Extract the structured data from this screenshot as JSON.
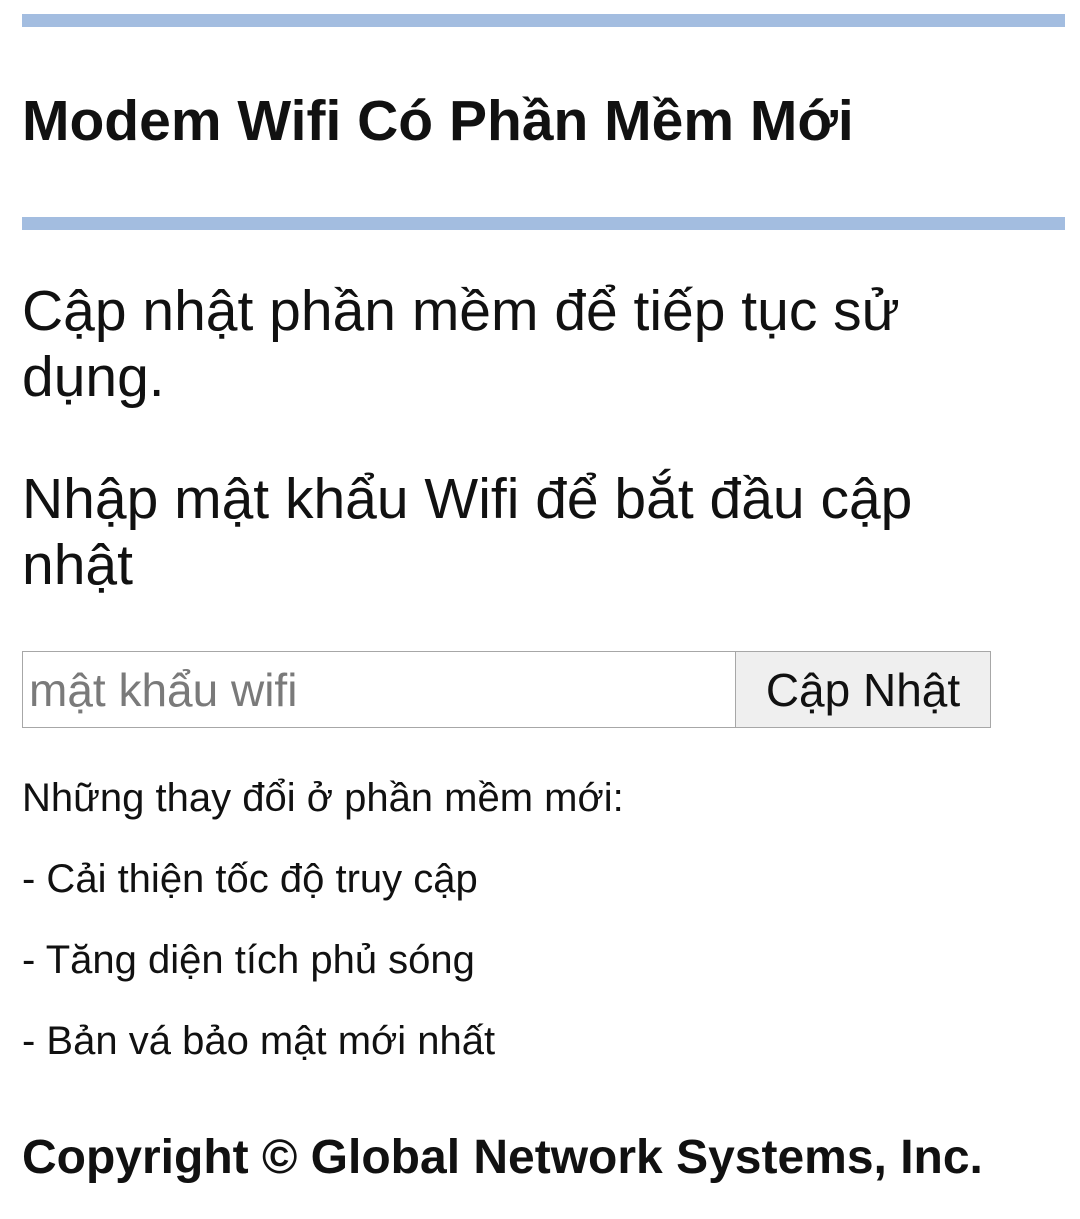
{
  "header": {
    "title": "Modem Wifi Có Phần Mềm Mới"
  },
  "main": {
    "message_1": "Cập nhật phần mềm để tiếp tục sử dụng.",
    "message_2": "Nhập mật khẩu Wifi để bắt đầu cập nhật",
    "password_input": {
      "value": "",
      "placeholder": "mật khẩu wifi"
    },
    "update_button_label": "Cập Nhật",
    "changes_heading": "Những thay đổi ở phần mềm mới:",
    "changes": [
      "- Cải thiện tốc độ truy cập",
      "- Tăng diện tích phủ sóng",
      "- Bản vá bảo mật mới nhất"
    ]
  },
  "footer": {
    "copyright": "Copyright © Global Network Systems, Inc."
  },
  "colors": {
    "rule": "#a3bde0",
    "text": "#111111",
    "button_bg": "#efefef",
    "border": "#a7a7a7"
  }
}
